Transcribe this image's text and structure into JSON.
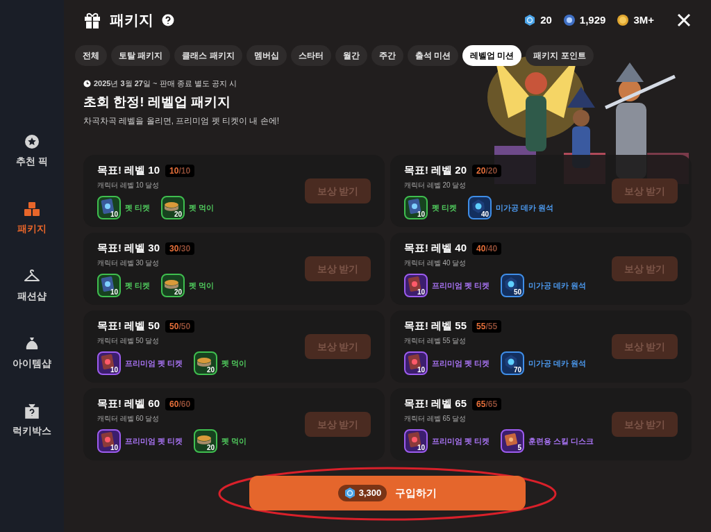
{
  "sidebar": {
    "items": [
      {
        "label": "추천 픽",
        "kind": "star",
        "selected": false
      },
      {
        "label": "패키지",
        "kind": "boxes",
        "selected": true
      },
      {
        "label": "패션샵",
        "kind": "hanger",
        "selected": false
      },
      {
        "label": "아이템샵",
        "kind": "bag",
        "selected": false
      },
      {
        "label": "럭키박스",
        "kind": "mystery",
        "selected": false
      }
    ]
  },
  "header": {
    "title": "패키지",
    "currencies": [
      {
        "kind": "gem",
        "amount": "20"
      },
      {
        "kind": "ore",
        "amount": "1,929"
      },
      {
        "kind": "coin",
        "amount": "3M+"
      }
    ]
  },
  "tabs": [
    {
      "label": "전체",
      "selected": false
    },
    {
      "label": "토탈 패키지",
      "selected": false
    },
    {
      "label": "클래스 패키지",
      "selected": false
    },
    {
      "label": "멤버십",
      "selected": false
    },
    {
      "label": "스타터",
      "selected": false
    },
    {
      "label": "월간",
      "selected": false
    },
    {
      "label": "주간",
      "selected": false
    },
    {
      "label": "출석 미션",
      "selected": false
    },
    {
      "label": "레벨업 미션",
      "selected": true
    },
    {
      "label": "패키지 포인트",
      "selected": false
    }
  ],
  "banner": {
    "date": "**2025**년 **3**월 **27**일 ~ 판매 종료 별도 공지 시",
    "title": "초회 한정! 레벨업 패키지",
    "subtitle": "차곡차곡 레벨을 올리면, 프리미엄 펫 티켓이 내 손에!"
  },
  "missions": [
    {
      "title": "목표! 레벨 10",
      "current": "10",
      "total": "/10",
      "desc": "캐릭터 레벨 10 달성",
      "rewards": [
        {
          "kind": "ticket",
          "count": "10",
          "name": "펫 티켓"
        },
        {
          "kind": "food",
          "count": "20",
          "name": "펫 먹이"
        }
      ],
      "button": {
        "label": "보상 받기",
        "disabled": true
      }
    },
    {
      "title": "목표! 레벨 20",
      "current": "20",
      "total": "/20",
      "desc": "캐릭터 레벨 20 달성",
      "rewards": [
        {
          "kind": "ticket",
          "count": "10",
          "name": "펫 티켓"
        },
        {
          "kind": "ore",
          "count": "40",
          "name": "미가공 데카 원석"
        }
      ],
      "button": {
        "label": "보상 받기",
        "disabled": true
      }
    },
    {
      "title": "목표! 레벨 30",
      "current": "30",
      "total": "/30",
      "desc": "캐릭터 레벨 30 달성",
      "rewards": [
        {
          "kind": "ticket",
          "count": "10",
          "name": "펫 티켓"
        },
        {
          "kind": "food",
          "count": "20",
          "name": "펫 먹이"
        }
      ],
      "button": {
        "label": "보상 받기",
        "disabled": true
      }
    },
    {
      "title": "목표! 레벨 40",
      "current": "40",
      "total": "/40",
      "desc": "캐릭터 레벨 40 달성",
      "rewards": [
        {
          "kind": "premium_ticket",
          "count": "10",
          "name": "프리미엄 펫 티켓"
        },
        {
          "kind": "ore",
          "count": "50",
          "name": "미가공 데카 원석"
        }
      ],
      "button": {
        "label": "보상 받기",
        "disabled": true
      }
    },
    {
      "title": "목표! 레벨 50",
      "current": "50",
      "total": "/50",
      "desc": "캐릭터 레벨 50 달성",
      "rewards": [
        {
          "kind": "premium_ticket",
          "count": "10",
          "name": "프리미엄 펫 티켓"
        },
        {
          "kind": "food",
          "count": "20",
          "name": "펫 먹이"
        }
      ],
      "button": {
        "label": "보상 받기",
        "disabled": true
      }
    },
    {
      "title": "목표! 레벨 55",
      "current": "55",
      "total": "/55",
      "desc": "캐릭터 레벨 55 달성",
      "rewards": [
        {
          "kind": "premium_ticket",
          "count": "10",
          "name": "프리미엄 펫 티켓"
        },
        {
          "kind": "ore",
          "count": "70",
          "name": "미가공 데카 원석"
        }
      ],
      "button": {
        "label": "보상 받기",
        "disabled": true
      }
    },
    {
      "title": "목표! 레벨 60",
      "current": "60",
      "total": "/60",
      "desc": "캐릭터 레벨 60 달성",
      "rewards": [
        {
          "kind": "premium_ticket",
          "count": "10",
          "name": "프리미엄 펫 티켓"
        },
        {
          "kind": "food",
          "count": "20",
          "name": "펫 먹이"
        }
      ],
      "button": {
        "label": "보상 받기",
        "disabled": true
      }
    },
    {
      "title": "목표! 레벨 65",
      "current": "65",
      "total": "/65",
      "desc": "캐릭터 레벨 65 달성",
      "rewards": [
        {
          "kind": "premium_ticket",
          "count": "10",
          "name": "프리미엄 펫 티켓"
        },
        {
          "kind": "disk",
          "count": "5",
          "name": "훈련용 스킬 디스크"
        }
      ],
      "button": {
        "label": "보상 받기",
        "disabled": true
      }
    }
  ],
  "purchase": {
    "price": "3,300",
    "label": "구입하기"
  }
}
